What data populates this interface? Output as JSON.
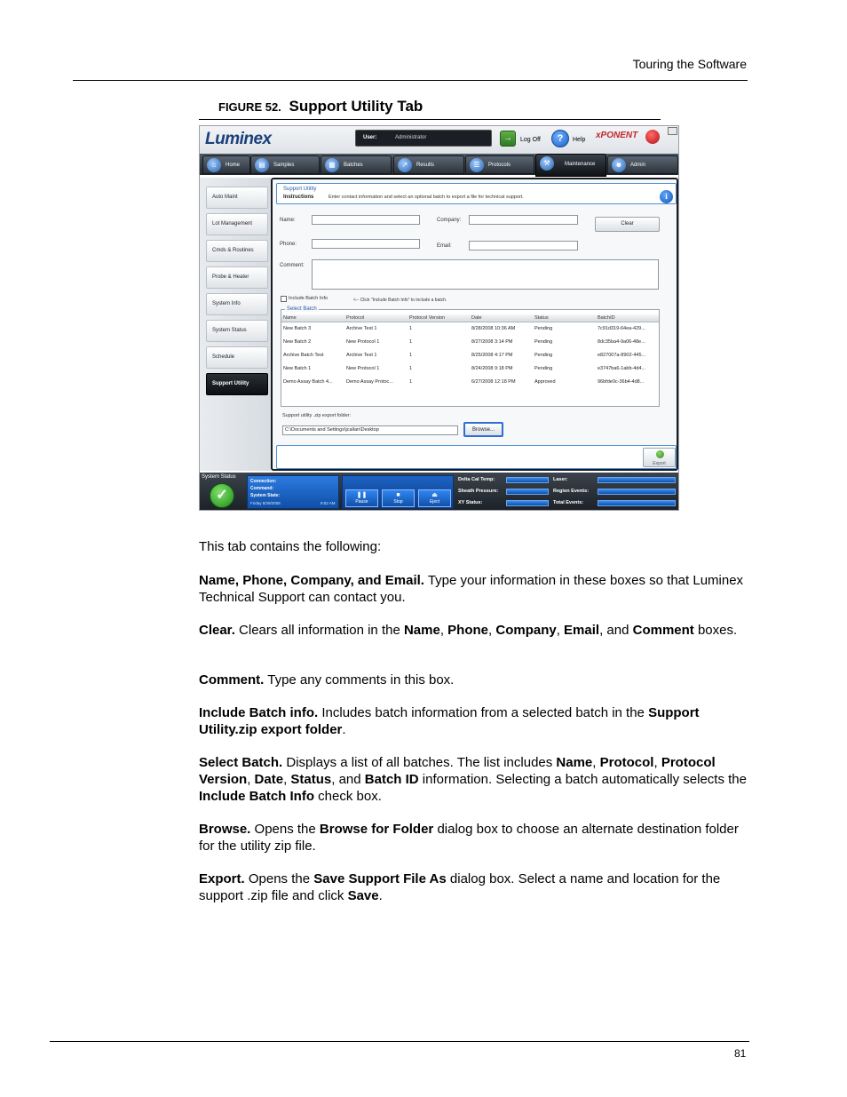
{
  "page": {
    "running_header": "Touring the Software",
    "figure_number": "FIGURE 52.",
    "figure_title": "Support Utility Tab",
    "page_number": "81"
  },
  "app": {
    "logo": "Luminex",
    "brand": "xPONENT",
    "user_label": "User:",
    "user_value": "Administrator",
    "logoff_label": "Log Off",
    "help_label": "Help",
    "colors": {
      "accent": "#2e6fd1",
      "tab_bar": "#2c333b",
      "brand_red": "#c2272d",
      "status_ok": "#1f8c19"
    },
    "tabs": [
      {
        "label": "Home",
        "icon": "home-icon"
      },
      {
        "label": "Samples",
        "icon": "samples-icon"
      },
      {
        "label": "Batches",
        "icon": "batches-icon"
      },
      {
        "label": "Results",
        "icon": "results-icon"
      },
      {
        "label": "Protocols",
        "icon": "protocols-icon"
      },
      {
        "label": "Maintenance",
        "icon": "maintenance-icon"
      },
      {
        "label": "Admin",
        "icon": "admin-icon"
      }
    ],
    "sidebar": [
      "Auto Maint",
      "Lot Management",
      "Cmds & Routines",
      "Probe & Heater",
      "System Info",
      "System Status",
      "Schedule",
      "Support Utility"
    ],
    "support": {
      "section_title": "Support Utility",
      "instructions_label": "Instructions",
      "instructions_text": "Enter contact information and select an optional batch to export a file for technical support.",
      "name_label": "Name:",
      "phone_label": "Phone:",
      "company_label": "Company:",
      "email_label": "Email:",
      "comment_label": "Comment:",
      "clear_button": "Clear",
      "include_batch_label": "Include Batch Info",
      "include_batch_hint": "<-- Click \"Include Batch Info\" to include a batch.",
      "select_batch_label": "Select Batch",
      "columns": [
        "Name",
        "Protocol",
        "Protocol Version",
        "Date",
        "Status",
        "BatchID"
      ],
      "rows": [
        [
          "New Batch 3",
          "Archive Test 1",
          "1",
          "8/28/2008 10:36 AM",
          "Pending",
          "7c91d319-64ea-429..."
        ],
        [
          "New Batch 2",
          "New Protocol 1",
          "1",
          "8/27/2008 3:14 PM",
          "Pending",
          "8dc35ba4-9a06-48e..."
        ],
        [
          "Archive Batch Test",
          "Archive Test 1",
          "1",
          "8/25/2008 4:17 PM",
          "Pending",
          "e827007a-8902-445..."
        ],
        [
          "New Batch 1",
          "New Protocol 1",
          "1",
          "8/24/2008 9:18 PM",
          "Pending",
          "e3747ba6-1abb-4d4..."
        ],
        [
          "Demo Assay Batch 4...",
          "Demo Assay Protoc...",
          "1",
          "6/27/2008 12:18 PM",
          "Approved",
          "96bfde0c-36b4-4d8..."
        ]
      ],
      "export_folder_label": "Support utility .zip export folder:",
      "export_folder_value": "C:\\Documents and Settings\\jcallan\\Desktop",
      "browse_button": "Browse...",
      "export_button": "Export"
    },
    "status": {
      "system_status_label": "System Status",
      "connection_label": "Connection:",
      "command_label": "Command:",
      "system_state_label": "System State:",
      "date_text": "Friday 8/29/2008",
      "time_text": "9:52 AM",
      "pause_label": "Pause",
      "stop_label": "Stop",
      "eject_label": "Eject",
      "delta_cal_temp_label": "Delta Cal Temp:",
      "sheath_pressure_label": "Sheath Pressure:",
      "xy_status_label": "XY Status:",
      "laser_label": "Laser:",
      "region_events_label": "Region Events:",
      "total_events_label": "Total Events:"
    }
  },
  "text": {
    "intro": "This tab contains the following:",
    "p1_b1": "Name, Phone, Company, and Email.",
    "p1_t1": " Type your information in these boxes so that Luminex Technical Support can contact you.",
    "p2_b1": "Clear.",
    "p2_t1": " Clears all information in the ",
    "p2_b2": "Name",
    "p2_t2": ", ",
    "p2_b3": "Phone",
    "p2_t3": ", ",
    "p2_b4": "Company",
    "p2_t4": ", ",
    "p2_b5": "Email",
    "p2_t5": ", and ",
    "p2_b6": "Comment",
    "p2_t6": " boxes.",
    "p3_b1": "Comment.",
    "p3_t1": " Type any comments in this box.",
    "p4_b1": "Include Batch info.",
    "p4_t1": " Includes batch information from a selected batch in the ",
    "p4_b2": "Support Utility.zip export folder",
    "p4_t2": ".",
    "p5_b1": "Select Batch.",
    "p5_t1": " Displays a list of all batches. The list includes ",
    "p5_b2": "Name",
    "p5_t2": ", ",
    "p5_b3": "Protocol",
    "p5_t3": ", ",
    "p5_b4": "Protocol Version",
    "p5_t4": ", ",
    "p5_b5": "Date",
    "p5_t5": ", ",
    "p5_b6": "Status",
    "p5_t6": ", and ",
    "p5_b7": "Batch ID",
    "p5_t7": " information. Selecting a batch automatically selects the ",
    "p5_b8": "Include Batch Info",
    "p5_t8": " check box.",
    "p6_b1": "Browse.",
    "p6_t1": " Opens the ",
    "p6_b2": "Browse for Folder",
    "p6_t2": " dialog box to choose an alternate destination folder for the utility zip file.",
    "p7_b1": "Export.",
    "p7_t1": " Opens the ",
    "p7_b2": "Save Support File As",
    "p7_t2": " dialog box. Select a name and location for the support .zip file and click ",
    "p7_b3": "Save",
    "p7_t3": "."
  }
}
